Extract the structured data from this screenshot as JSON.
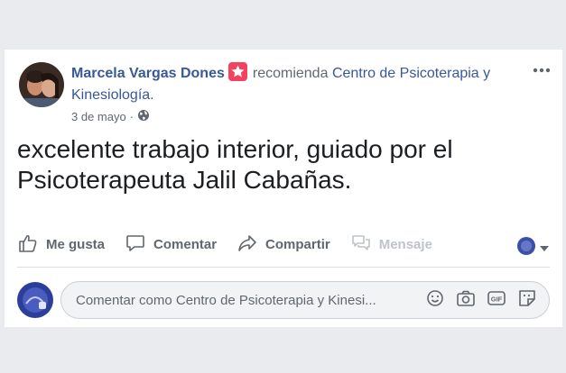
{
  "post": {
    "author": "Marcela Vargas Dones",
    "action_text": "recomienda",
    "page_name": "Centro de Psicoterapia y Kinesiología.",
    "date": "3 de mayo",
    "privacy_icon": "globe-icon",
    "text": "excelente trabajo interior, guiado por el Psicoterapeuta Jalil Cabañas."
  },
  "actions": {
    "like": "Me gusta",
    "comment": "Comentar",
    "share": "Compartir",
    "message": "Mensaje"
  },
  "composer": {
    "placeholder": "Comentar como Centro de Psicoterapia y Kinesi..."
  },
  "colors": {
    "link": "#385898",
    "badge": "#f3425f",
    "muted": "#606770",
    "disabled": "#bec3c9"
  }
}
